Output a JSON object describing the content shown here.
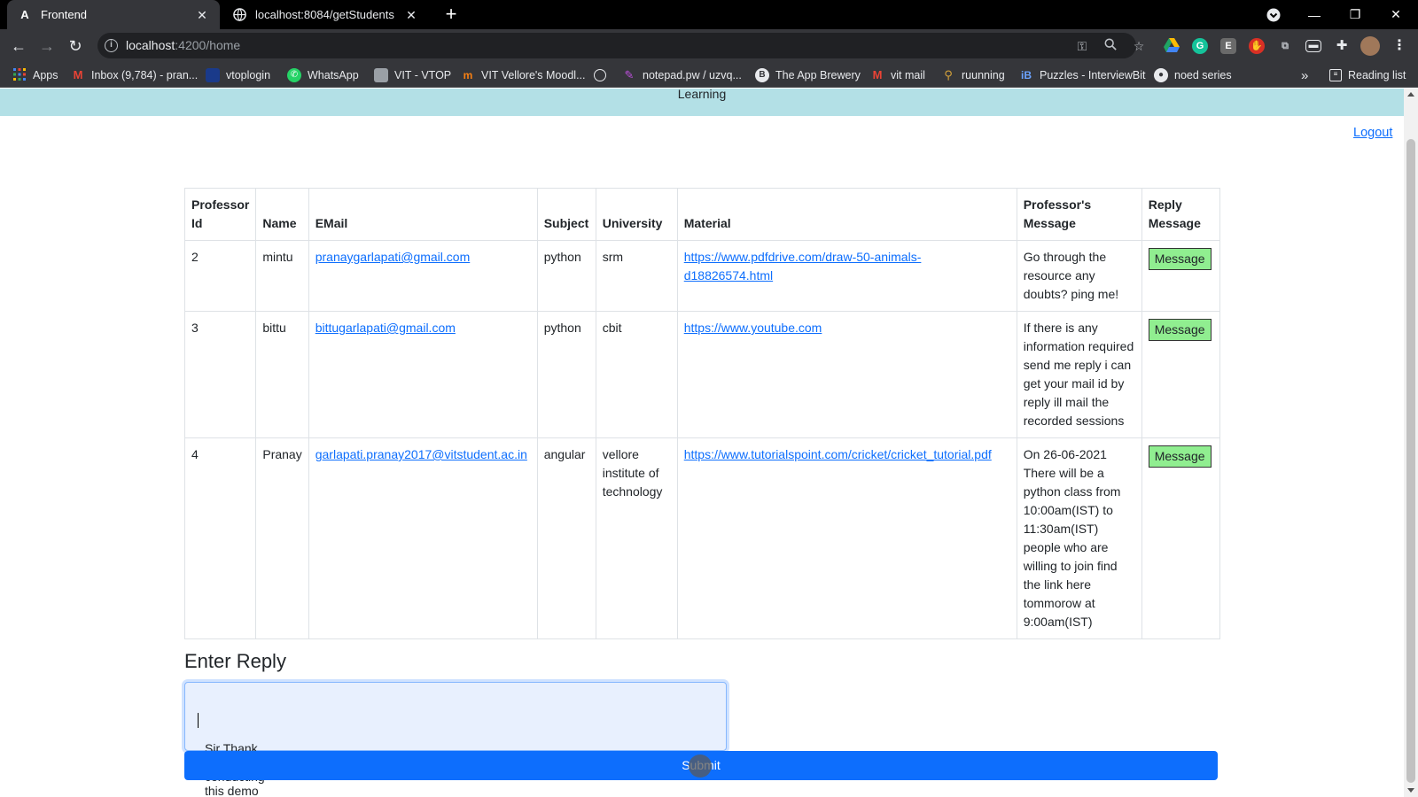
{
  "browser": {
    "tabs": [
      {
        "title": "Frontend",
        "icon": "angular-icon",
        "active": true
      },
      {
        "title": "localhost:8084/getStudents",
        "icon": "globe-icon",
        "active": false
      }
    ],
    "url_host": "localhost",
    "url_rest": ":4200/home",
    "bookmarks": [
      {
        "label": "Apps",
        "icon": "apps-grid-icon",
        "color": "#e8eaed"
      },
      {
        "label": "Inbox (9,784) - pran...",
        "icon": "gmail-icon",
        "color": "#ea4335"
      },
      {
        "label": "vtoplogin",
        "icon": "vtop-icon",
        "color": "#1a3a8a"
      },
      {
        "label": "WhatsApp",
        "icon": "whatsapp-icon",
        "color": "#25d366"
      },
      {
        "label": "VIT - VTOP",
        "icon": "vtop-icon",
        "color": "#9aa0a6"
      },
      {
        "label": "VIT Vellore's Moodl...",
        "icon": "moodle-icon",
        "color": "#f98012"
      },
      {
        "label": "",
        "icon": "site-icon",
        "color": "#9aa0a6"
      },
      {
        "label": "notepad.pw / uzvq...",
        "icon": "notepad-icon",
        "color": "#c050e0"
      },
      {
        "label": "The App Brewery",
        "icon": "appbrewery-icon",
        "color": "#e8eaed"
      },
      {
        "label": "vit mail",
        "icon": "gmail-icon",
        "color": "#ea4335"
      },
      {
        "label": "ruunning",
        "icon": "runner-icon",
        "color": "#d4a23a"
      },
      {
        "label": "Puzzles - InterviewBit",
        "icon": "interviewbit-icon",
        "color": "#6ba3ff"
      },
      {
        "label": "noed series",
        "icon": "github-icon",
        "color": "#e8eaed"
      }
    ],
    "more_bookmarks": "»",
    "reading_list": "Reading list"
  },
  "page": {
    "banner_text": "Learning",
    "logout_label": "Logout",
    "table": {
      "headers": [
        "Professor Id",
        "Name",
        "EMail",
        "Subject",
        "University",
        "Material",
        "Professor's Message",
        "Reply Message"
      ],
      "rows": [
        {
          "id": "2",
          "name": "mintu",
          "email": "pranaygarlapati@gmail.com",
          "subject": "python",
          "university": "srm",
          "material": "https://www.pdfdrive.com/draw-50-animals-d18826574.html",
          "message": "Go through the resource any doubts? ping me!",
          "button": "Message"
        },
        {
          "id": "3",
          "name": "bittu",
          "email": "bittugarlapati@gmail.com",
          "subject": "python",
          "university": "cbit",
          "material": "https://www.youtube.com",
          "message": "If there is any information required send me reply i can get your mail id by reply ill mail the recorded sessions",
          "button": "Message"
        },
        {
          "id": "4",
          "name": "Pranay",
          "email": "garlapati.pranay2017@vitstudent.ac.in",
          "subject": "angular",
          "university": "vellore institute of technology",
          "material": "https://www.tutorialspoint.com/cricket/cricket_tutorial.pdf",
          "message": "On 26-06-2021 There will be a python class from 10:00am(IST) to 11:30am(IST) people who are willing to join find the link here tommorow at 9:00am(IST)",
          "button": "Message"
        }
      ]
    },
    "reply_heading": "Enter Reply",
    "reply_value": "Sir Thank you for conducting this demo",
    "submit_label": "Submit"
  },
  "colors": {
    "banner": "#b3e0e6",
    "submit": "#0d6efd",
    "message_button": "#90ee90",
    "link": "#0d6efd"
  }
}
